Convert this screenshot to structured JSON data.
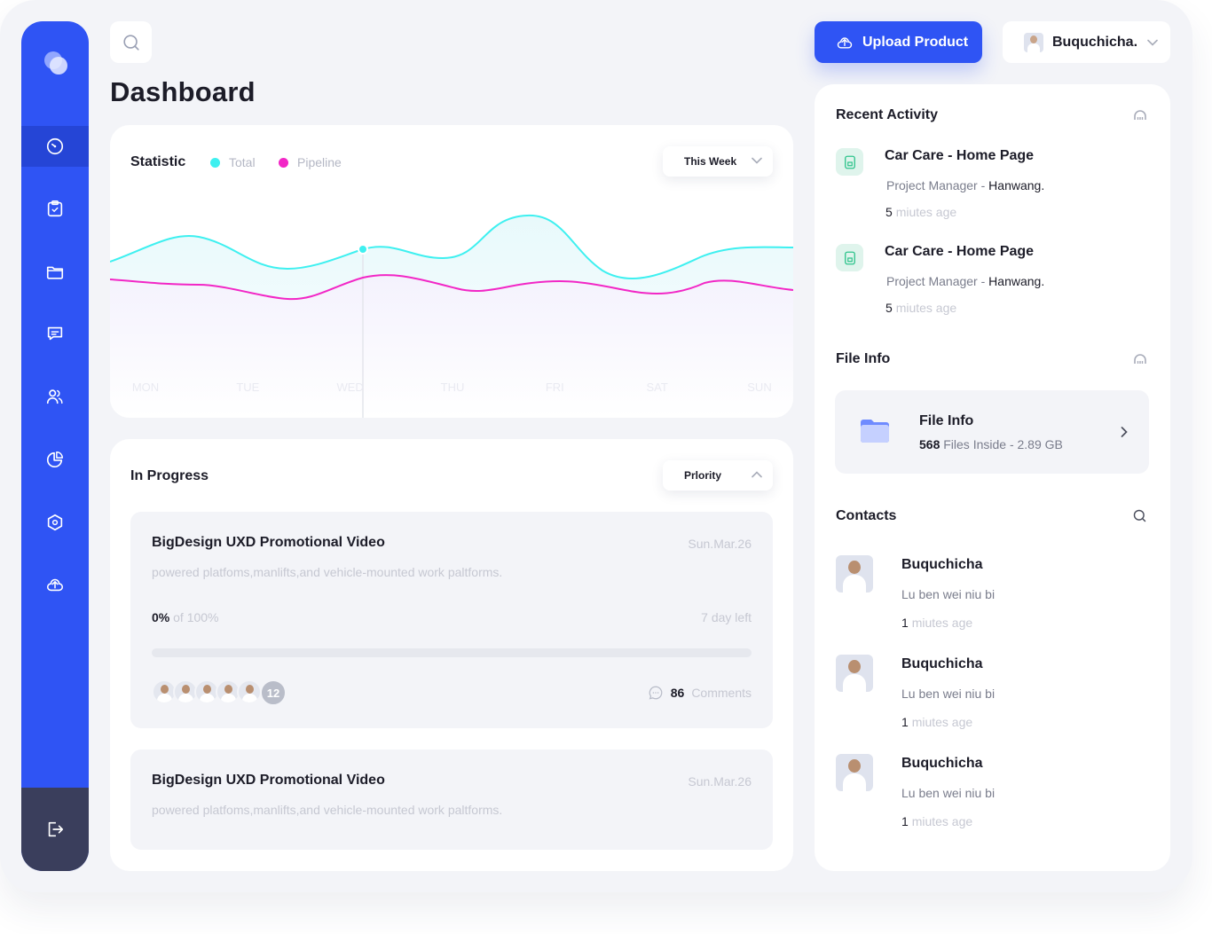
{
  "header": {
    "title": "Dashboard",
    "upload_label": "Upload Product",
    "user_name": "Buquchicha."
  },
  "statistic": {
    "title": "Statistic",
    "legend": [
      {
        "name": "Total",
        "color": "#3ef0f0"
      },
      {
        "name": "Pipeline",
        "color": "#f227c6"
      }
    ],
    "range_label": "This Week",
    "chart_data": {
      "type": "area",
      "categories": [
        "MON",
        "TUE",
        "WED",
        "THU",
        "FRI",
        "SAT",
        "SUN"
      ],
      "highlighted": "WED"
    }
  },
  "in_progress": {
    "title": "In Progress",
    "sort_label": "Prlority",
    "tasks": [
      {
        "title": "BigDesign UXD Promotional Video",
        "date": "Sun.Mar.26",
        "desc": "powered platfoms,manlifts,and vehicle-mounted work paltforms.",
        "pct": "0%",
        "pct_of": "of 100%",
        "progress_fraction": 0,
        "days_left": "7 day left",
        "member_count": "12",
        "comments_count": "86",
        "comments_label": "Comments"
      },
      {
        "title": "BigDesign UXD Promotional Video",
        "date": "Sun.Mar.26",
        "desc": "powered platfoms,manlifts,and vehicle-mounted work paltforms."
      }
    ]
  },
  "recent_activity": {
    "title": "Recent Activity",
    "items": [
      {
        "title": "Car Care - Home Page",
        "role": "Project Manager - ",
        "org": "Hanwang.",
        "time_num": "5",
        "time_text": "miutes age"
      },
      {
        "title": "Car Care - Home Page",
        "role": "Project Manager - ",
        "org": "Hanwang.",
        "time_num": "5",
        "time_text": "miutes age"
      }
    ]
  },
  "file_info": {
    "section_title": "File Info",
    "title": "File Info",
    "count": "568",
    "summary": " Files Inside - 2.89 GB"
  },
  "contacts": {
    "title": "Contacts",
    "items": [
      {
        "name": "Buquchicha",
        "sub": "Lu ben wei niu bi",
        "time_num": "1",
        "time_text": "miutes age"
      },
      {
        "name": "Buquchicha",
        "sub": "Lu ben wei niu bi",
        "time_num": "1",
        "time_text": "miutes age"
      },
      {
        "name": "Buquchicha",
        "sub": "Lu ben wei niu bi",
        "time_num": "1",
        "time_text": "miutes age"
      }
    ]
  },
  "colors": {
    "accent": "#2f54f4",
    "sidebar_bottom": "#3a3e5c",
    "total": "#3ef0f0",
    "pipeline": "#f227c6"
  },
  "icons": [
    "logo-icon",
    "dashboard-icon",
    "clipboard-icon",
    "folder-icon",
    "chat-icon",
    "users-icon",
    "pie-chart-icon",
    "hexagon-icon",
    "upload-cloud-icon",
    "logout-icon",
    "search-icon",
    "chevron-down-icon",
    "chevron-up-icon",
    "chevron-right-icon",
    "comment-icon",
    "document-icon"
  ]
}
